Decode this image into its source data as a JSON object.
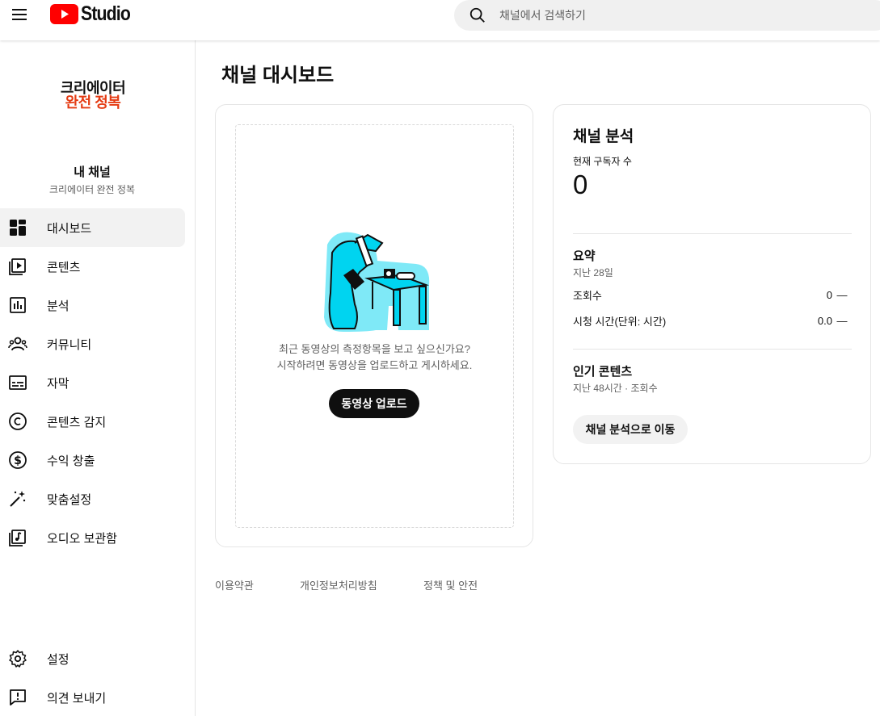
{
  "header": {
    "logo_text": "Studio",
    "search_placeholder": "채널에서 검색하기"
  },
  "sidebar": {
    "avatar_line1": "크리에이터",
    "avatar_line2": "완전 정복",
    "channel_label": "내 채널",
    "channel_name": "크리에이터 완전 정복",
    "items": [
      {
        "label": "대시보드",
        "icon": "dashboard-icon",
        "active": true
      },
      {
        "label": "콘텐츠",
        "icon": "content-icon"
      },
      {
        "label": "분석",
        "icon": "analytics-icon"
      },
      {
        "label": "커뮤니티",
        "icon": "community-icon"
      },
      {
        "label": "자막",
        "icon": "subtitles-icon"
      },
      {
        "label": "콘텐츠 감지",
        "icon": "copyright-icon"
      },
      {
        "label": "수익 창출",
        "icon": "monetization-icon"
      },
      {
        "label": "맞춤설정",
        "icon": "customization-icon"
      },
      {
        "label": "오디오 보관함",
        "icon": "audio-library-icon"
      }
    ],
    "bottom_items": [
      {
        "label": "설정",
        "icon": "settings-icon"
      },
      {
        "label": "의견 보내기",
        "icon": "feedback-icon"
      }
    ]
  },
  "main": {
    "title": "채널 대시보드",
    "upload_card": {
      "line1": "최근 동영상의 측정항목을 보고 싶으신가요?",
      "line2": "시작하려면 동영상을 업로드하고 게시하세요.",
      "button": "동영상 업로드"
    },
    "analytics_card": {
      "title": "채널 분석",
      "subscribers_label": "현재 구독자 수",
      "subscribers_count": "0",
      "summary_title": "요약",
      "summary_period": "지난 28일",
      "metrics": [
        {
          "label": "조회수",
          "value": "0",
          "trend": "—"
        },
        {
          "label": "시청 시간(단위: 시간)",
          "value": "0.0",
          "trend": "—"
        }
      ],
      "top_content_title": "인기 콘텐츠",
      "top_content_sub": "지난 48시간 · 조회수",
      "button": "채널 분석으로 이동"
    },
    "footer": [
      "이용약관",
      "개인정보처리방침",
      "정책 및 안전"
    ]
  },
  "colors": {
    "youtube_red": "#ff0000",
    "brand_accent": "#e53b13",
    "illustration_cyan": "#00d4f0"
  }
}
